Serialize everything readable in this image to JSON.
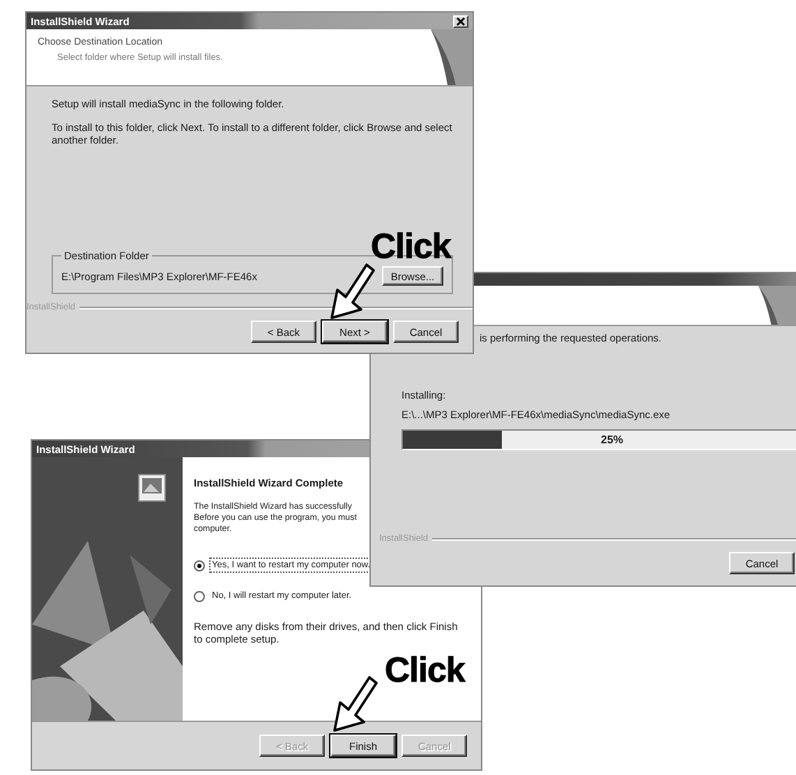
{
  "destination_dialog": {
    "title": "InstallShield Wizard",
    "heading": "Choose Destination Location",
    "subheading": "Select folder where Setup will install files.",
    "paragraphs": [
      "Setup will install mediaSync in the following folder.",
      "To install to this folder, click Next. To install to a different folder, click Browse and select another folder."
    ],
    "group_label": "Destination Folder",
    "folder_path": "E:\\Program Files\\MP3 Explorer\\MF-FE46x",
    "browse_button": "Browse...",
    "brand": "InstallShield",
    "buttons": [
      {
        "label": "< Back",
        "default": false,
        "disabled": false
      },
      {
        "label": "Next >",
        "default": true,
        "disabled": false
      },
      {
        "label": "Cancel",
        "default": false,
        "disabled": false
      }
    ]
  },
  "progress_dialog": {
    "message": "is performing the requested operations.",
    "status_label": "Installing:",
    "file_path": "E:\\...\\MP3 Explorer\\MF-FE46x\\mediaSync\\mediaSync.exe",
    "progress": {
      "level": 0.25,
      "reading": "25%"
    },
    "brand": "InstallShield",
    "buttons": [
      {
        "label": "Cancel",
        "default": false,
        "disabled": false
      }
    ]
  },
  "complete_dialog": {
    "title": "InstallShield Wizard",
    "heading": "InstallShield Wizard Complete",
    "paragraph_lines": [
      "The InstallShield Wizard has successfully",
      "Before you can use the program, you must",
      "computer."
    ],
    "options": [
      {
        "label": "Yes, I want to restart my computer now.",
        "selected": true
      },
      {
        "label": "No, I will restart my computer later.",
        "selected": false
      }
    ],
    "closing": "Remove any disks from their drives, and then click Finish to complete setup.",
    "buttons": [
      {
        "label": "< Back",
        "default": false,
        "disabled": true
      },
      {
        "label": "Finish",
        "default": true,
        "disabled": false
      },
      {
        "label": "Cancel",
        "default": false,
        "disabled": true
      }
    ]
  },
  "annotations": [
    {
      "text": "Click"
    },
    {
      "text": "Click"
    }
  ]
}
